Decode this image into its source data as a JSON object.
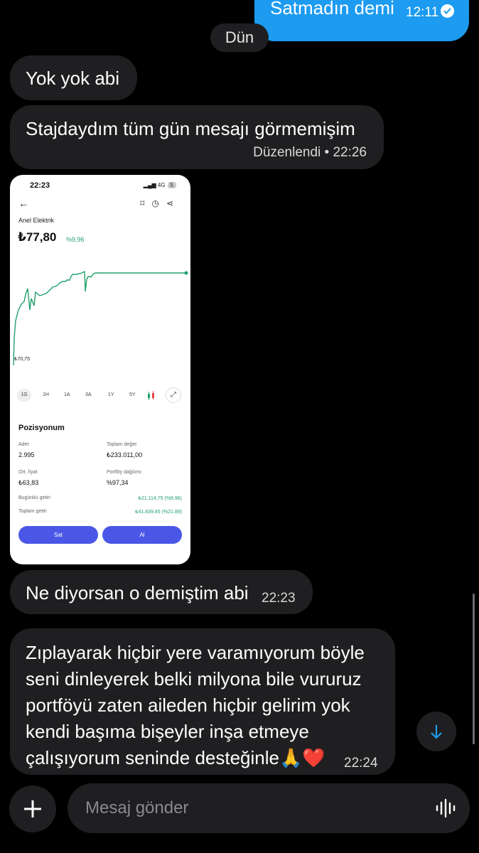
{
  "sent_message": {
    "text": "Satmadın demi",
    "time": "12:11"
  },
  "day_chip": "Dün",
  "messages": [
    {
      "text": "Yok yok abi"
    },
    {
      "text": "Stajdaydım tüm gün  mesajı görmemişim",
      "meta": "Düzenlendi • 22:26"
    },
    {
      "text": "Ne diyorsan o demiştim abi",
      "time": "22:23"
    },
    {
      "text": "Zıplayarak hiçbir yere varamıyorum böyle seni dinleyerek belki milyona bile vururuz portföyü zaten aileden hiçbir gelirim yok kendi başıma bişeyler inşa etmeye çalışıyorum seninde desteğinle🙏❤️",
      "time": "22:24"
    }
  ],
  "shared_screenshot": {
    "status_time": "22:23",
    "network": "4G",
    "battery": "5",
    "stock_name": "Anel Elektrik",
    "price": "₺77,80",
    "change": "%9,96",
    "low_label": "₺70,75",
    "ranges": [
      "1G",
      "1H",
      "1A",
      "3A",
      "1Y",
      "5Y"
    ],
    "section_title": "Pozisyonum",
    "fields": {
      "adet_label": "Adet",
      "adet_value": "2.995",
      "toplam_label": "Toplam değer",
      "toplam_value": "₺233.011,00",
      "ort_label": "Ort. fiyat",
      "ort_value": "₺63,83",
      "portfoy_label": "Portföy dağılımı",
      "portfoy_value": "%97,34",
      "bugun_label": "Bugünkü getiri",
      "bugun_value": "₺21.114,75 (%9,96)",
      "toplam_getiri_label": "Toplam getiri",
      "toplam_getiri_value": "₺41.839,45 (%21,89)"
    },
    "sell_label": "Sat",
    "buy_label": "Al",
    "accent_green": "#22a06b",
    "button_color": "#4a57e6"
  },
  "composer": {
    "placeholder": "Mesaj gönder"
  },
  "colors": {
    "bubble_in": "#1f1f21",
    "bubble_out": "#1d9bf0",
    "background": "#000000"
  }
}
